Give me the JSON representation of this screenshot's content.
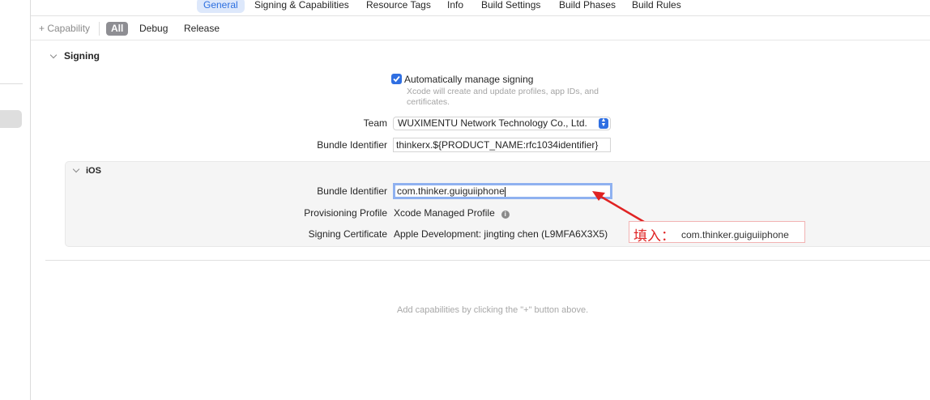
{
  "tabs": {
    "general": "General",
    "signing": "Signing & Capabilities",
    "resource_tags": "Resource Tags",
    "info": "Info",
    "build_settings": "Build Settings",
    "build_phases": "Build Phases",
    "build_rules": "Build Rules",
    "active": "General"
  },
  "filter_bar": {
    "add_capability": "+ Capability",
    "all": "All",
    "debug": "Debug",
    "release": "Release",
    "selected": "All"
  },
  "signing": {
    "title": "Signing",
    "auto_manage_label": "Automatically manage signing",
    "auto_manage_checked": true,
    "auto_manage_desc": "Xcode will create and update profiles, app IDs, and certificates.",
    "team_label": "Team",
    "team_value": "WUXIMENTU Network Technology Co., Ltd.",
    "bundle_id_label": "Bundle Identifier",
    "bundle_id_value": "thinkerx.${PRODUCT_NAME:rfc1034identifier}"
  },
  "ios": {
    "title": "iOS",
    "bundle_id_label": "Bundle Identifier",
    "bundle_id_value": "com.thinker.guiguiiphone",
    "provisioning_label": "Provisioning Profile",
    "provisioning_value": "Xcode Managed Profile",
    "certificate_label": "Signing Certificate",
    "certificate_value": "Apple Development: jingting chen (L9MFA6X3X5)"
  },
  "annotation": {
    "prefix": "填入：",
    "value": "com.thinker.guiguiiphone",
    "color": "#e02323"
  },
  "empty_message": "Add capabilities by clicking the \"+\" button above.",
  "accent_color": "#2f6fe2"
}
